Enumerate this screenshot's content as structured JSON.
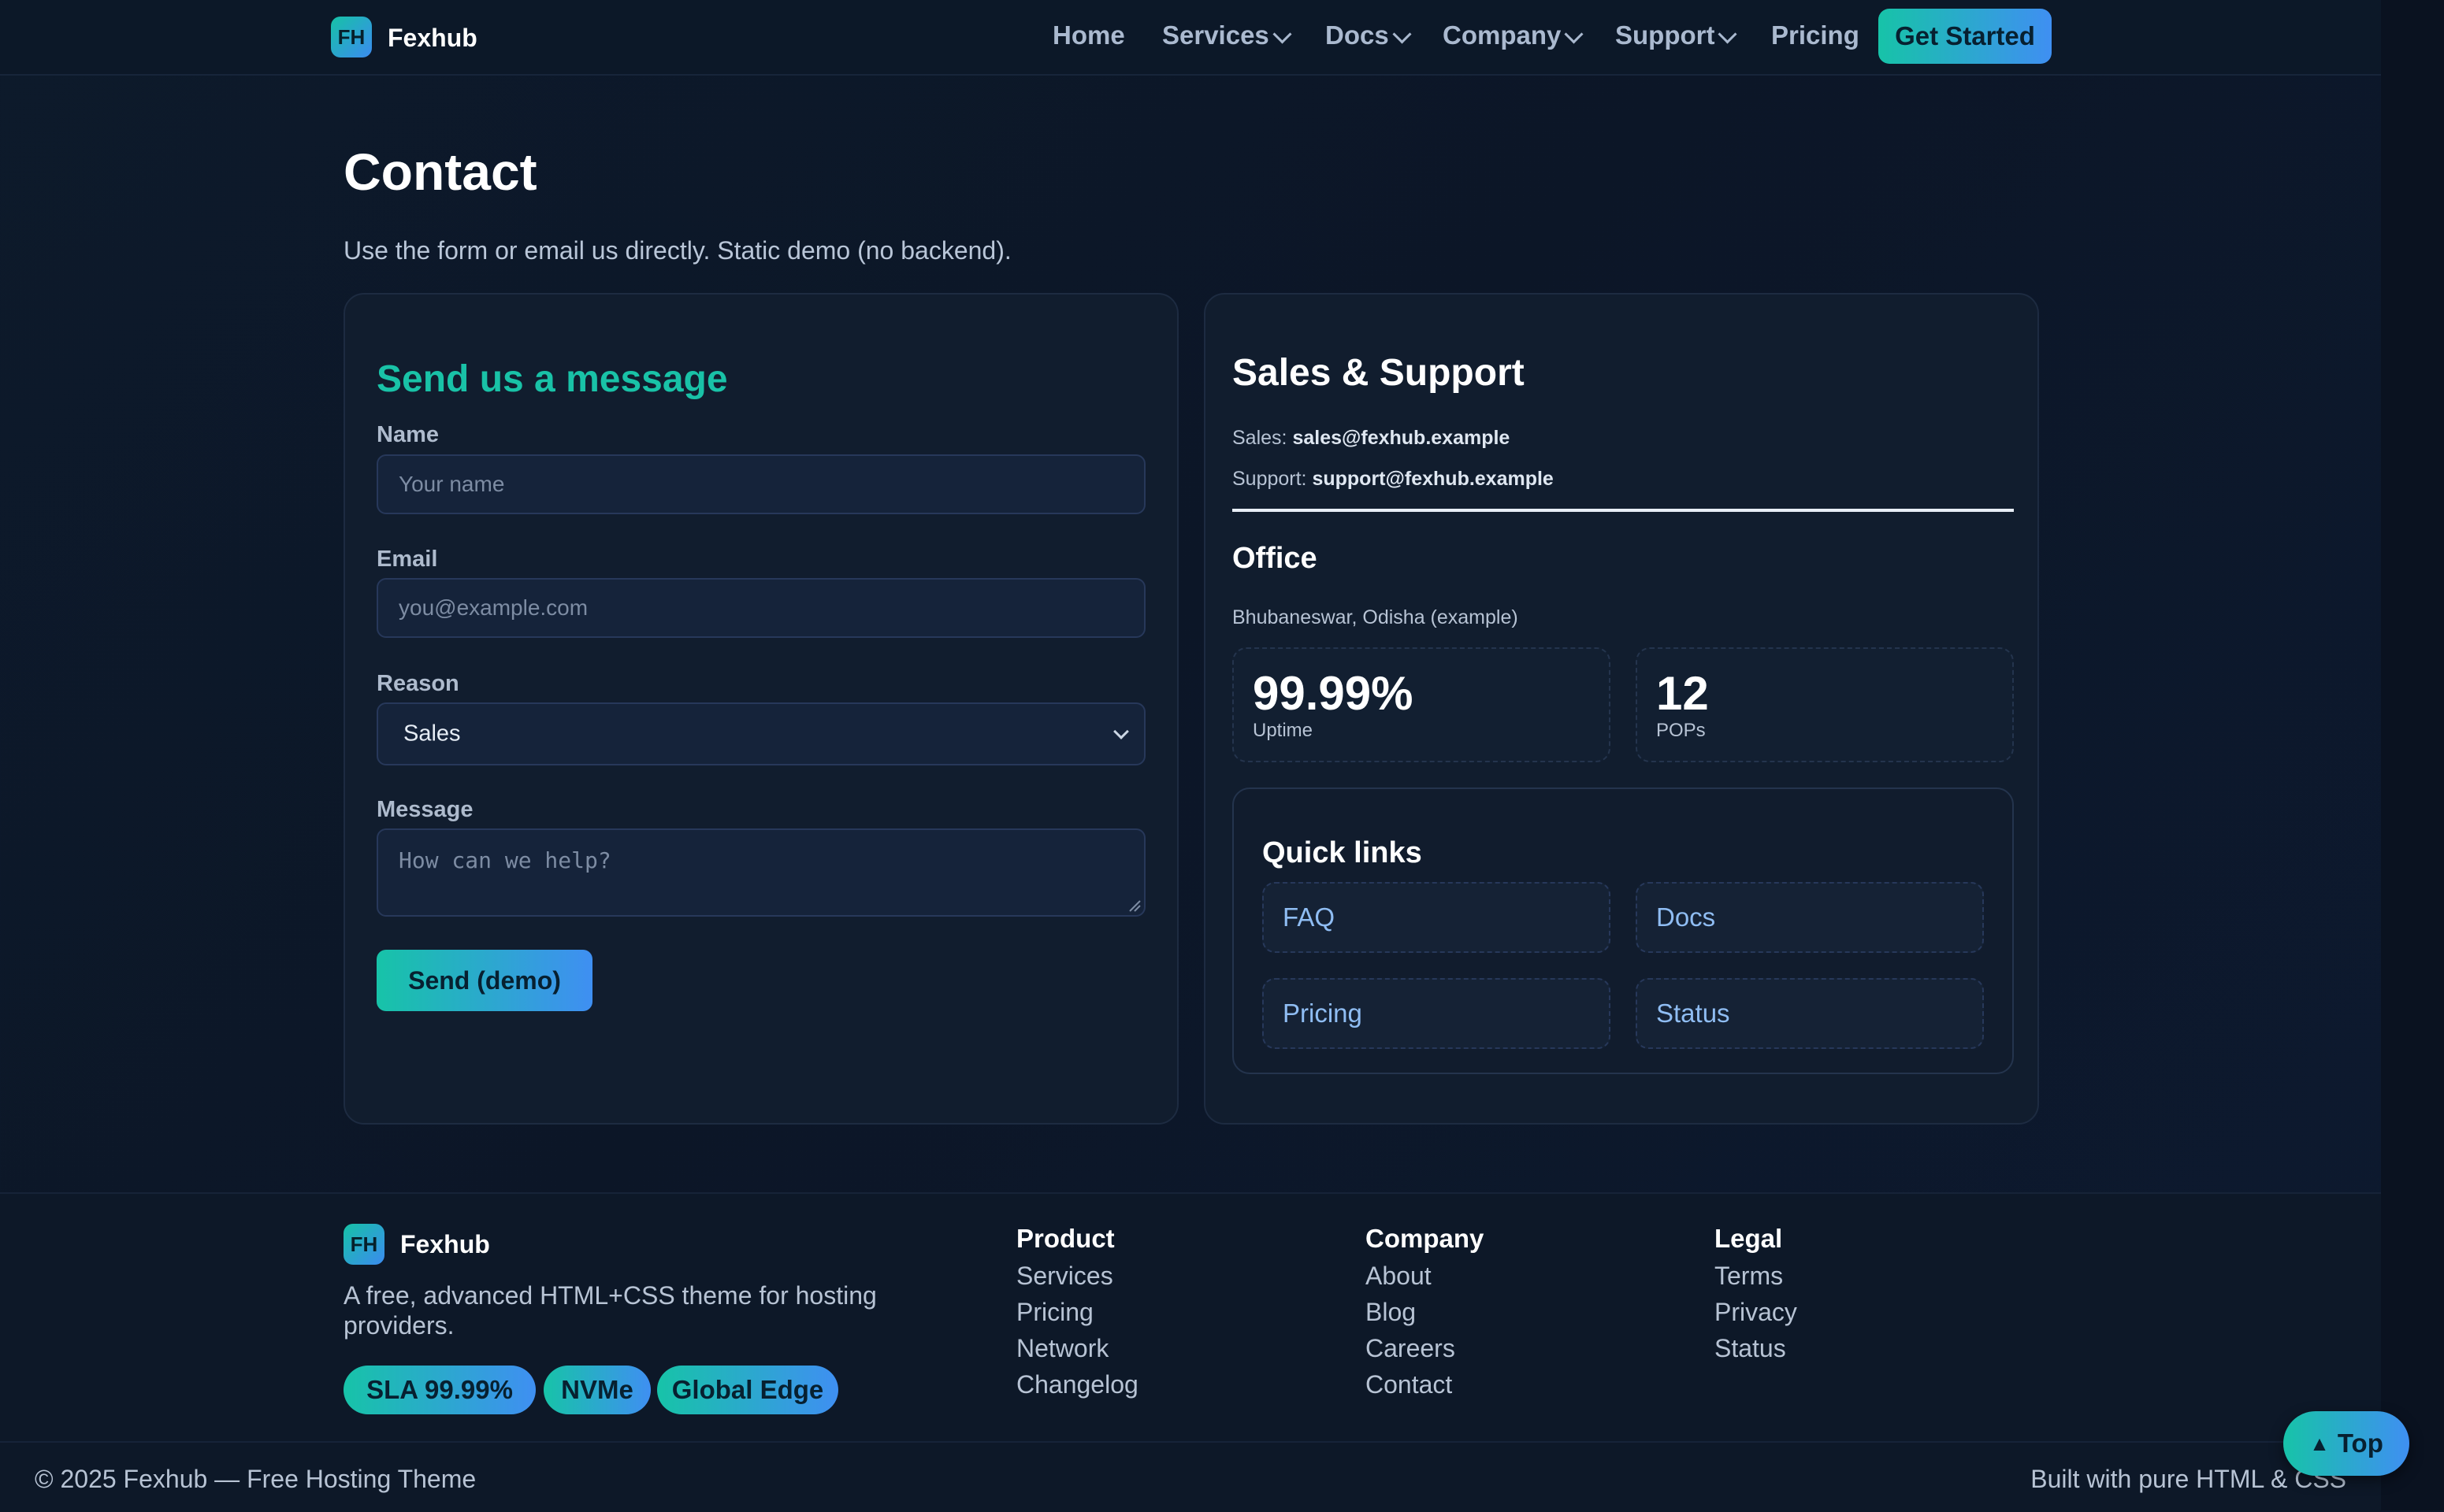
{
  "nav": {
    "logo_text": "FH",
    "brand": "Fexhub",
    "items": [
      {
        "label": "Home",
        "dropdown": false
      },
      {
        "label": "Services",
        "dropdown": true
      },
      {
        "label": "Docs",
        "dropdown": true
      },
      {
        "label": "Company",
        "dropdown": true
      },
      {
        "label": "Support",
        "dropdown": true
      },
      {
        "label": "Pricing",
        "dropdown": false
      }
    ],
    "cta": "Get Started"
  },
  "hero": {
    "title": "Contact",
    "subtitle": "Use the form or email us directly. Static demo (no backend)."
  },
  "form": {
    "title": "Send us a message",
    "name_label": "Name",
    "name_placeholder": "Your name",
    "email_label": "Email",
    "email_placeholder": "you@example.com",
    "reason_label": "Reason",
    "reason_selected": "Sales",
    "message_label": "Message",
    "message_placeholder": "How can we help?",
    "submit": "Send (demo)"
  },
  "contact": {
    "title": "Sales & Support",
    "sales_label": "Sales:",
    "sales_email": "sales@fexhub.example",
    "support_label": "Support:",
    "support_email": "support@fexhub.example",
    "office_title": "Office",
    "office_location": "Bhubaneswar, Odisha (example)",
    "stats": [
      {
        "value": "99.99%",
        "caption": "Uptime"
      },
      {
        "value": "12",
        "caption": "POPs"
      }
    ],
    "quick_links_title": "Quick links",
    "quick_links": [
      "FAQ",
      "Docs",
      "Pricing",
      "Status"
    ]
  },
  "footer": {
    "logo_text": "FH",
    "brand": "Fexhub",
    "description": "A free, advanced HTML+CSS theme for hosting providers.",
    "pills": [
      "SLA 99.99%",
      "NVMe",
      "Global Edge"
    ],
    "columns": [
      {
        "heading": "Product",
        "links": [
          "Services",
          "Pricing",
          "Network",
          "Changelog"
        ]
      },
      {
        "heading": "Company",
        "links": [
          "About",
          "Blog",
          "Careers",
          "Contact"
        ]
      },
      {
        "heading": "Legal",
        "links": [
          "Terms",
          "Privacy",
          "Status"
        ]
      }
    ],
    "copyright": "© 2025 Fexhub — Free Hosting Theme",
    "built_with": "Built with pure HTML & CSS",
    "top_button": "Top",
    "top_icon": "▲"
  },
  "colors": {
    "accent_teal": "#19c2a7",
    "accent_blue": "#3f8ff2",
    "background": "#0c1627",
    "card": "#111d2e"
  }
}
